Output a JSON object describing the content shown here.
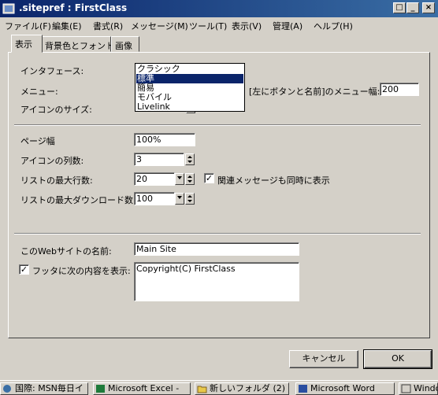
{
  "window": {
    "title": ".sitepref : FirstClass",
    "minimize": "_",
    "maximize": "□",
    "close": "×"
  },
  "menu": [
    "ファイル(F)",
    "編集(E)",
    "書式(R)",
    "メッセージ(M)",
    "ツール(T)",
    "表示(V)",
    "管理(A)",
    "ヘルプ(H)"
  ],
  "tabs": [
    "表示",
    "背景色とフォント",
    "画像"
  ],
  "display": {
    "interface_label": "インタフェース:",
    "interface_options": [
      "クラシック",
      "標準",
      "簡易",
      "モバイル",
      "Livelink"
    ],
    "interface_selected": "標準",
    "menu_label": "メニュー:",
    "menu_width_label": "[左にボタンと名前]のメニュー幅:",
    "menu_width_value": "200",
    "icon_size_label": "アイコンのサイズ:",
    "page_width_label": "ページ幅",
    "page_width_value": "100%",
    "icon_columns_label": "アイコンの列数:",
    "icon_columns_value": "3",
    "max_list_rows_label": "リストの最大行数:",
    "max_list_rows_value": "20",
    "show_related_label": "関連メッセージも同時に表示",
    "show_related_checked": "✓",
    "max_download_label": "リストの最大ダウンロード数:",
    "max_download_value": "100",
    "site_name_label": "このWebサイトの名前:",
    "site_name_value": "Main Site",
    "footer_label": "フッタに次の内容を表示:",
    "footer_checked": "✓",
    "footer_value": "Copyright(C) FirstClass"
  },
  "buttons": {
    "cancel": "キャンセル",
    "ok": "OK"
  },
  "taskbar": [
    "国際: MSN毎日イ",
    "Microsoft Excel -",
    "新しいフォルダ (2)",
    "Microsoft Word",
    "Windo"
  ],
  "colors": {
    "titlebar_start": "#0a246a",
    "titlebar_end": "#3a6ea5",
    "selection": "#0a246a",
    "face": "#d4d0c8"
  }
}
